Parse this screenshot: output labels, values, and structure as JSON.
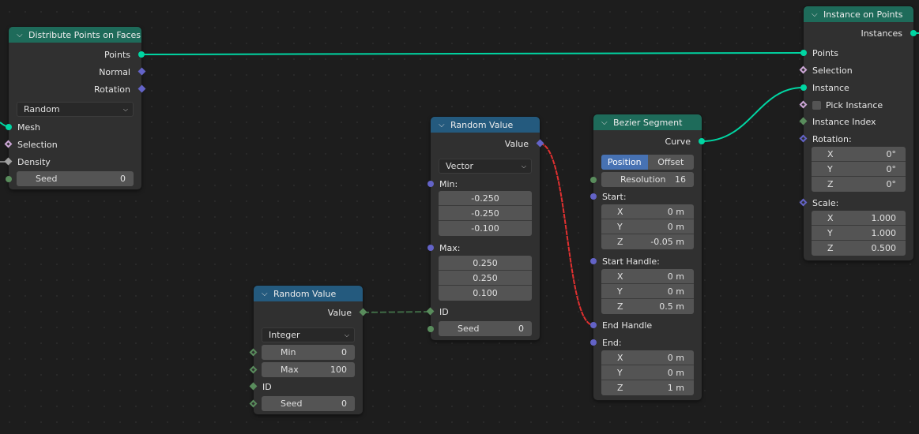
{
  "colors": {
    "geometry_socket": "#00d6a3",
    "vector_socket": "#6363c7",
    "int_socket": "#598c5c",
    "bool_socket": "#cca6d6",
    "float_socket": "#a1a1a1",
    "geometry_header": "#1e6b5a",
    "utility_header": "#245a7e",
    "invalid_link": "#e03030"
  },
  "nodes": {
    "distribute": {
      "title": "Distribute Points on Faces",
      "outputs": [
        "Points",
        "Normal",
        "Rotation"
      ],
      "mode": "Random",
      "inputs": [
        "Mesh",
        "Selection",
        "Density"
      ],
      "seed_label": "Seed",
      "seed_value": "0"
    },
    "instance_on_points": {
      "title": "Instance on Points",
      "output": "Instances",
      "inputs": [
        "Points",
        "Selection",
        "Instance",
        "Pick Instance",
        "Instance Index"
      ],
      "rotation_label": "Rotation:",
      "rotation": [
        {
          "axis": "X",
          "value": "0°"
        },
        {
          "axis": "Y",
          "value": "0°"
        },
        {
          "axis": "Z",
          "value": "0°"
        }
      ],
      "scale_label": "Scale:",
      "scale": [
        {
          "axis": "X",
          "value": "1.000"
        },
        {
          "axis": "Y",
          "value": "1.000"
        },
        {
          "axis": "Z",
          "value": "0.500"
        }
      ]
    },
    "random_vector": {
      "title": "Random Value",
      "output": "Value",
      "type": "Vector",
      "min_label": "Min:",
      "min": [
        "-0.250",
        "-0.250",
        "-0.100"
      ],
      "max_label": "Max:",
      "max": [
        "0.250",
        "0.250",
        "0.100"
      ],
      "id_label": "ID",
      "seed_label": "Seed",
      "seed_value": "0"
    },
    "random_int": {
      "title": "Random Value",
      "output": "Value",
      "type": "Integer",
      "min_label": "Min",
      "min_value": "0",
      "max_label": "Max",
      "max_value": "100",
      "id_label": "ID",
      "seed_label": "Seed",
      "seed_value": "0"
    },
    "bezier": {
      "title": "Bezier Segment",
      "output": "Curve",
      "mode_options": [
        "Position",
        "Offset"
      ],
      "mode_selected": "Position",
      "resolution_label": "Resolution",
      "resolution_value": "16",
      "start_label": "Start:",
      "start": [
        {
          "axis": "X",
          "value": "0 m"
        },
        {
          "axis": "Y",
          "value": "0 m"
        },
        {
          "axis": "Z",
          "value": "-0.05 m"
        }
      ],
      "start_handle_label": "Start Handle:",
      "start_handle": [
        {
          "axis": "X",
          "value": "0 m"
        },
        {
          "axis": "Y",
          "value": "0 m"
        },
        {
          "axis": "Z",
          "value": "0.5 m"
        }
      ],
      "end_handle_label": "End Handle",
      "end_label": "End:",
      "end": [
        {
          "axis": "X",
          "value": "0 m"
        },
        {
          "axis": "Y",
          "value": "0 m"
        },
        {
          "axis": "Z",
          "value": "1 m"
        }
      ]
    }
  },
  "icons": {
    "collapse": "⌵",
    "dropdown": "⌄"
  }
}
